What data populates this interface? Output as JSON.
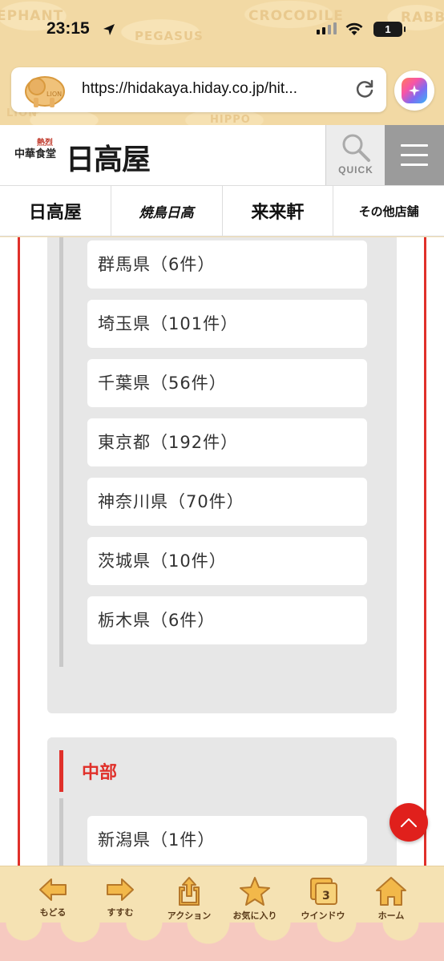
{
  "status_bar": {
    "time": "23:15",
    "battery": "1"
  },
  "browser": {
    "url": "https://hidakaya.hiday.co.jp/hit...",
    "toolbar": [
      {
        "label": "もどる",
        "icon": "back-arrow-icon"
      },
      {
        "label": "すすむ",
        "icon": "forward-arrow-icon"
      },
      {
        "label": "アクション",
        "icon": "share-icon"
      },
      {
        "label": "お気に入り",
        "icon": "star-icon"
      },
      {
        "label": "ウインドウ",
        "icon": "tabs-icon",
        "count": "3"
      },
      {
        "label": "ホーム",
        "icon": "home-icon"
      }
    ]
  },
  "background_words": [
    "EPHANT",
    "PEGASUS",
    "CROCODILE",
    "RABBI",
    "LION",
    "LION",
    "HIPPO"
  ],
  "site": {
    "logo_small_top": "熱烈",
    "logo_small_bottom": "中華食堂",
    "logo_main": "日高屋",
    "quick_label": "QUICK",
    "brands": [
      "日高屋",
      "焼鳥日高",
      "来来軒",
      "その他店舗"
    ]
  },
  "regions": [
    {
      "name": "",
      "prefectures": [
        "群馬県（6件）",
        "埼玉県（101件）",
        "千葉県（56件）",
        "東京都（192件）",
        "神奈川県（70件）",
        "茨城県（10件）",
        "栃木県（6件）"
      ]
    },
    {
      "name": "中部",
      "prefectures": [
        "新潟県（1件）"
      ]
    }
  ],
  "colors": {
    "accent_red": "#e0302a",
    "panel_gray": "#e7e7e7",
    "toolbar_bg": "#f5e2b3"
  }
}
